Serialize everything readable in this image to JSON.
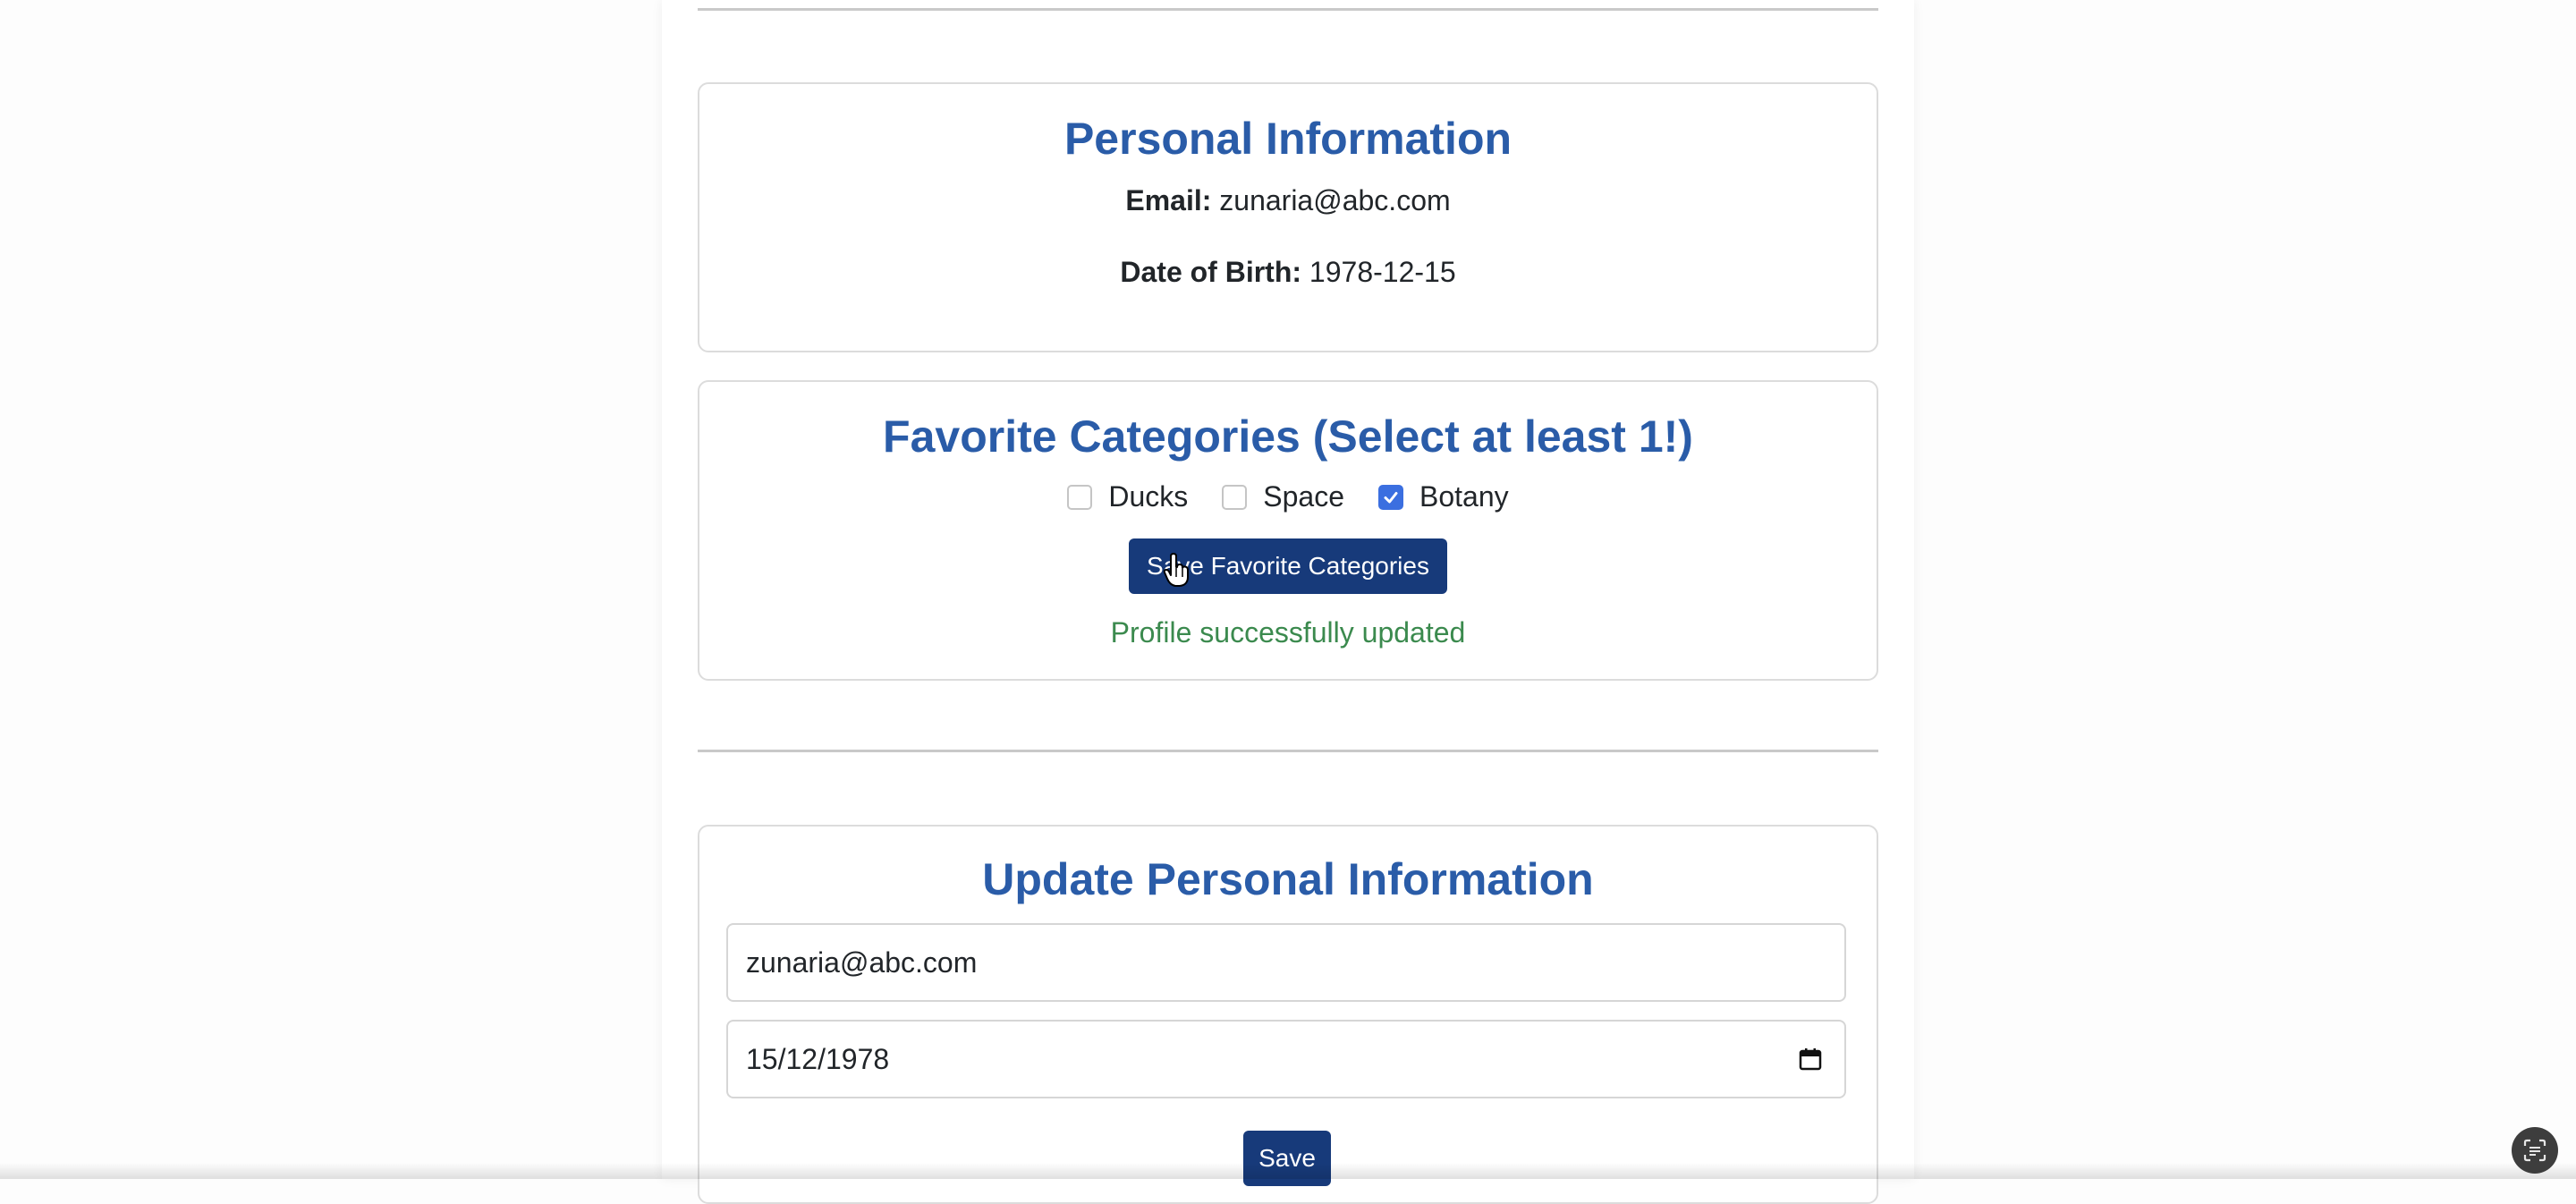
{
  "personal_info": {
    "title": "Personal Information",
    "email_label": "Email:",
    "email_value": "zunaria@abc.com",
    "dob_label": "Date of Birth:",
    "dob_value": "1978-12-15"
  },
  "favorites": {
    "title": "Favorite Categories (Select at least 1!)",
    "options": [
      {
        "label": "Ducks",
        "checked": false
      },
      {
        "label": "Space",
        "checked": false
      },
      {
        "label": "Botany",
        "checked": true
      }
    ],
    "save_label": "Save Favorite Categories",
    "status_message": "Profile successfully updated"
  },
  "update_info": {
    "title": "Update Personal Information",
    "email_value": "zunaria@abc.com",
    "date_value": "15/12/1978",
    "save_label": "Save"
  },
  "colors": {
    "heading": "#2a5ca8",
    "button": "#173a7a",
    "success": "#3b8a4e",
    "checkbox_checked": "#3b6fe0"
  }
}
